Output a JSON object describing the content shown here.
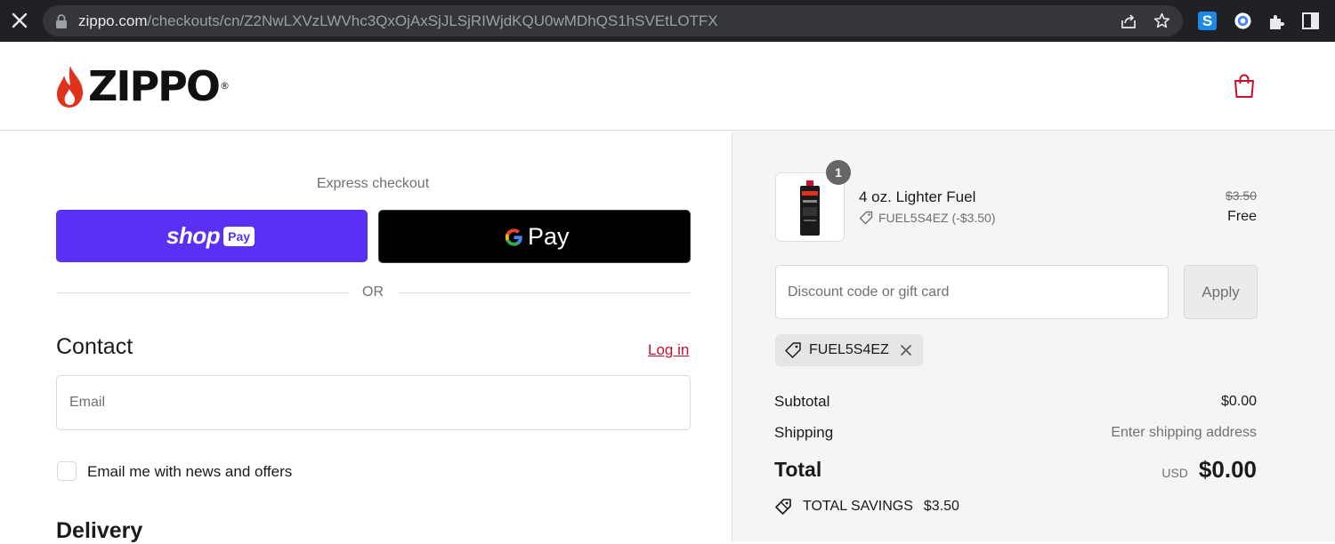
{
  "browser": {
    "url_host": "zippo.com",
    "url_path": "/checkouts/cn/Z2NwLXVzLWVhc3QxOjAxSjJLSjRIWjdKQU0wMDhQS1hSVEtLOTFX"
  },
  "header": {
    "logo_text": "ZIPPO",
    "logo_mark": "®"
  },
  "checkout": {
    "express_label": "Express checkout",
    "shop_pay": {
      "word": "shop",
      "badge": "Pay"
    },
    "google_pay": {
      "word": "Pay"
    },
    "or_label": "OR",
    "contact_title": "Contact",
    "login_label": "Log in",
    "email_placeholder": "Email",
    "news_label": "Email me with news and offers",
    "delivery_title": "Delivery"
  },
  "summary": {
    "item": {
      "quantity": "1",
      "name": "4 oz. Lighter Fuel",
      "discount": "FUEL5S4EZ (-$3.50)",
      "original_price": "$3.50",
      "price": "Free"
    },
    "discount_placeholder": "Discount code or gift card",
    "apply_label": "Apply",
    "applied_code": "FUEL5S4EZ",
    "subtotal_label": "Subtotal",
    "subtotal_value": "$0.00",
    "shipping_label": "Shipping",
    "shipping_value": "Enter shipping address",
    "total_label": "Total",
    "total_currency": "USD",
    "total_value": "$0.00",
    "savings_label": "TOTAL SAVINGS",
    "savings_value": "$3.50"
  },
  "colors": {
    "accent_red": "#c41230",
    "shop_pay_purple": "#5a31f4",
    "summary_bg": "#f5f5f5"
  }
}
